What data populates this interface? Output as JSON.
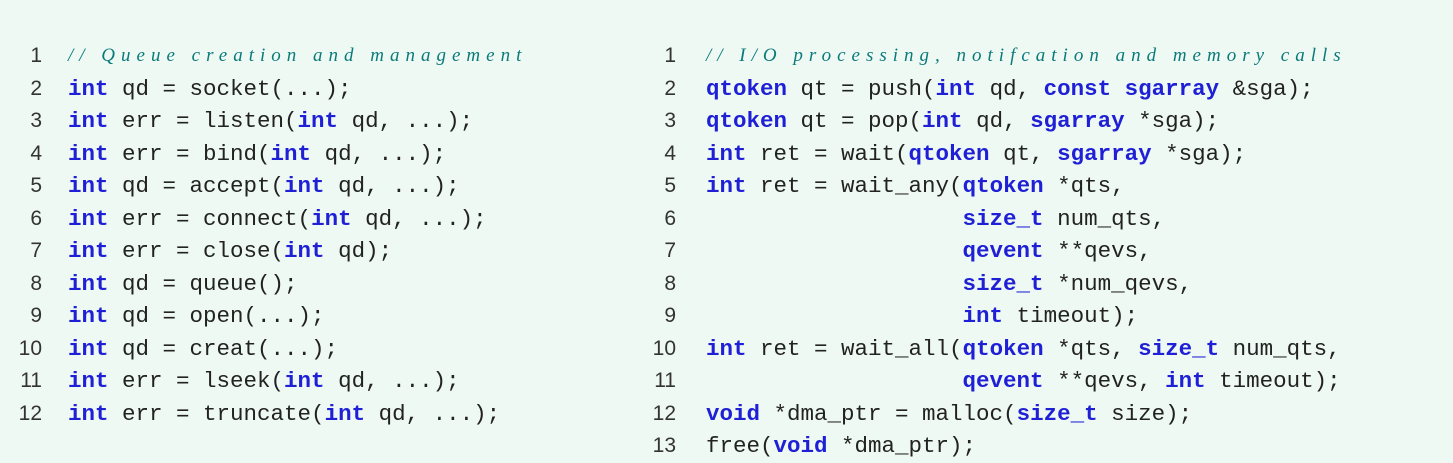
{
  "left_listing": [
    {
      "n": "1",
      "tokens": [
        {
          "t": "cm",
          "v": "// Queue creation and management"
        }
      ]
    },
    {
      "n": "2",
      "tokens": [
        {
          "t": "kw",
          "v": "int"
        },
        {
          "t": "pl",
          "v": " qd = socket(...);"
        }
      ]
    },
    {
      "n": "3",
      "tokens": [
        {
          "t": "kw",
          "v": "int"
        },
        {
          "t": "pl",
          "v": " err = listen("
        },
        {
          "t": "kw",
          "v": "int"
        },
        {
          "t": "pl",
          "v": " qd, ...);"
        }
      ]
    },
    {
      "n": "4",
      "tokens": [
        {
          "t": "kw",
          "v": "int"
        },
        {
          "t": "pl",
          "v": " err = bind("
        },
        {
          "t": "kw",
          "v": "int"
        },
        {
          "t": "pl",
          "v": " qd, ...);"
        }
      ]
    },
    {
      "n": "5",
      "tokens": [
        {
          "t": "kw",
          "v": "int"
        },
        {
          "t": "pl",
          "v": " qd = accept("
        },
        {
          "t": "kw",
          "v": "int"
        },
        {
          "t": "pl",
          "v": " qd, ...);"
        }
      ]
    },
    {
      "n": "6",
      "tokens": [
        {
          "t": "kw",
          "v": "int"
        },
        {
          "t": "pl",
          "v": " err = connect("
        },
        {
          "t": "kw",
          "v": "int"
        },
        {
          "t": "pl",
          "v": " qd, ...);"
        }
      ]
    },
    {
      "n": "7",
      "tokens": [
        {
          "t": "kw",
          "v": "int"
        },
        {
          "t": "pl",
          "v": " err = close("
        },
        {
          "t": "kw",
          "v": "int"
        },
        {
          "t": "pl",
          "v": " qd);"
        }
      ]
    },
    {
      "n": "8",
      "tokens": [
        {
          "t": "kw",
          "v": "int"
        },
        {
          "t": "pl",
          "v": " qd = queue();"
        }
      ]
    },
    {
      "n": "9",
      "tokens": [
        {
          "t": "kw",
          "v": "int"
        },
        {
          "t": "pl",
          "v": " qd = open(...);"
        }
      ]
    },
    {
      "n": "10",
      "tokens": [
        {
          "t": "kw",
          "v": "int"
        },
        {
          "t": "pl",
          "v": " qd = creat(...);"
        }
      ]
    },
    {
      "n": "11",
      "tokens": [
        {
          "t": "kw",
          "v": "int"
        },
        {
          "t": "pl",
          "v": " err = lseek("
        },
        {
          "t": "kw",
          "v": "int"
        },
        {
          "t": "pl",
          "v": " qd, ...);"
        }
      ]
    },
    {
      "n": "12",
      "tokens": [
        {
          "t": "kw",
          "v": "int"
        },
        {
          "t": "pl",
          "v": " err = truncate("
        },
        {
          "t": "kw",
          "v": "int"
        },
        {
          "t": "pl",
          "v": " qd, ...);"
        }
      ]
    }
  ],
  "right_listing": [
    {
      "n": "1",
      "tokens": [
        {
          "t": "cm",
          "v": "// I/O processing, notifcation and memory calls"
        }
      ]
    },
    {
      "n": "2",
      "tokens": [
        {
          "t": "kw",
          "v": "qtoken"
        },
        {
          "t": "pl",
          "v": " qt = push("
        },
        {
          "t": "kw",
          "v": "int"
        },
        {
          "t": "pl",
          "v": " qd, "
        },
        {
          "t": "kw",
          "v": "const sgarray"
        },
        {
          "t": "pl",
          "v": " &sga);"
        }
      ]
    },
    {
      "n": "3",
      "tokens": [
        {
          "t": "kw",
          "v": "qtoken"
        },
        {
          "t": "pl",
          "v": " qt = pop("
        },
        {
          "t": "kw",
          "v": "int"
        },
        {
          "t": "pl",
          "v": " qd, "
        },
        {
          "t": "kw",
          "v": "sgarray"
        },
        {
          "t": "pl",
          "v": " *sga);"
        }
      ]
    },
    {
      "n": "4",
      "tokens": [
        {
          "t": "kw",
          "v": "int"
        },
        {
          "t": "pl",
          "v": " ret = wait("
        },
        {
          "t": "kw",
          "v": "qtoken"
        },
        {
          "t": "pl",
          "v": " qt, "
        },
        {
          "t": "kw",
          "v": "sgarray"
        },
        {
          "t": "pl",
          "v": " *sga);"
        }
      ]
    },
    {
      "n": "5",
      "tokens": [
        {
          "t": "kw",
          "v": "int"
        },
        {
          "t": "pl",
          "v": " ret = wait_any("
        },
        {
          "t": "kw",
          "v": "qtoken"
        },
        {
          "t": "pl",
          "v": " *qts,"
        }
      ]
    },
    {
      "n": "6",
      "tokens": [
        {
          "t": "pl",
          "v": "                   "
        },
        {
          "t": "kw",
          "v": "size_t"
        },
        {
          "t": "pl",
          "v": " num_qts,"
        }
      ]
    },
    {
      "n": "7",
      "tokens": [
        {
          "t": "pl",
          "v": "                   "
        },
        {
          "t": "kw",
          "v": "qevent"
        },
        {
          "t": "pl",
          "v": " **qevs,"
        }
      ]
    },
    {
      "n": "8",
      "tokens": [
        {
          "t": "pl",
          "v": "                   "
        },
        {
          "t": "kw",
          "v": "size_t"
        },
        {
          "t": "pl",
          "v": " *num_qevs,"
        }
      ]
    },
    {
      "n": "9",
      "tokens": [
        {
          "t": "pl",
          "v": "                   "
        },
        {
          "t": "kw",
          "v": "int"
        },
        {
          "t": "pl",
          "v": " timeout);"
        }
      ]
    },
    {
      "n": "10",
      "tokens": [
        {
          "t": "kw",
          "v": "int"
        },
        {
          "t": "pl",
          "v": " ret = wait_all("
        },
        {
          "t": "kw",
          "v": "qtoken"
        },
        {
          "t": "pl",
          "v": " *qts, "
        },
        {
          "t": "kw",
          "v": "size_t"
        },
        {
          "t": "pl",
          "v": " num_qts,"
        }
      ]
    },
    {
      "n": "11",
      "tokens": [
        {
          "t": "pl",
          "v": "                   "
        },
        {
          "t": "kw",
          "v": "qevent"
        },
        {
          "t": "pl",
          "v": " **qevs, "
        },
        {
          "t": "kw",
          "v": "int"
        },
        {
          "t": "pl",
          "v": " timeout);"
        }
      ]
    },
    {
      "n": "12",
      "tokens": [
        {
          "t": "kw",
          "v": "void"
        },
        {
          "t": "pl",
          "v": " *dma_ptr = malloc("
        },
        {
          "t": "kw",
          "v": "size_t"
        },
        {
          "t": "pl",
          "v": " size);"
        }
      ]
    },
    {
      "n": "13",
      "tokens": [
        {
          "t": "pl",
          "v": "free("
        },
        {
          "t": "kw",
          "v": "void"
        },
        {
          "t": "pl",
          "v": " *dma_ptr);"
        }
      ]
    }
  ],
  "colors": {
    "background": "#eef9f4",
    "keyword": "#1f1fd6",
    "comment": "#0a7a7a",
    "text": "#222222"
  }
}
